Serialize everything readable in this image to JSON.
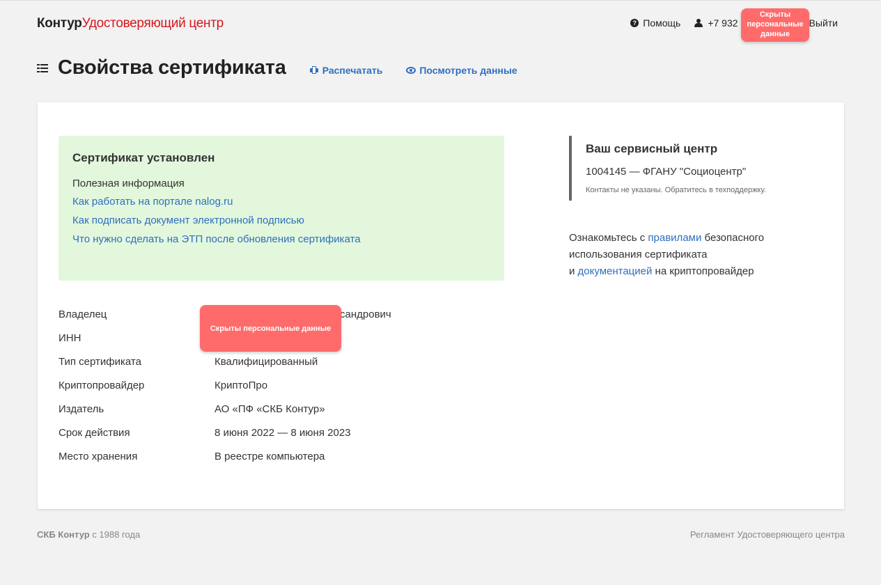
{
  "header": {
    "logo_brand": "Контур",
    "logo_product": "Удостоверяющий центр",
    "help_label": "Помощь",
    "phone_prefix": "+7 932",
    "logout_label": "Выйти",
    "redacted_label": "Скрыты персональные данные"
  },
  "title_row": {
    "title": "Свойства сертификата",
    "print_label": "Распечатать",
    "view_data_label": "Посмотреть данные"
  },
  "status": {
    "title": "Сертификат установлен",
    "useful_info": "Полезная информация",
    "links": [
      "Как работать на портале nalog.ru",
      "Как подписать документ электронной подписью",
      "Что нужно сделать на ЭТП после обновления сертификата"
    ]
  },
  "properties": [
    {
      "label": "Владелец",
      "value": "сандрович"
    },
    {
      "label": "ИНН",
      "value": ""
    },
    {
      "label": "Тип сертификата",
      "value": "Квалифицированный"
    },
    {
      "label": "Криптопровайдер",
      "value": "КриптоПро"
    },
    {
      "label": "Издатель",
      "value": "АО «ПФ «СКБ Контур»"
    },
    {
      "label": "Срок действия",
      "value": "8 июня 2022 — 8 июня 2023"
    },
    {
      "label": "Место хранения",
      "value": "В реестре компьютера"
    }
  ],
  "redacted_mid_label": "Скрыты персональные данные",
  "service_center": {
    "title": "Ваш сервисный центр",
    "id_name": "1004145 — ФГАНУ \"Социоцентр\"",
    "note": "Контакты не указаны. Обратитесь в техподдержку."
  },
  "rules": {
    "part1": "Ознакомьтесь с ",
    "link1": "правилами",
    "part2": " безопасного использования сертификата",
    "part3": "и ",
    "link2": "документацией",
    "part4": " на криптопровайдер"
  },
  "footer": {
    "company": "СКБ Контур",
    "since": " с 1988 года",
    "regulation": "Регламент Удостоверяющего центра"
  }
}
